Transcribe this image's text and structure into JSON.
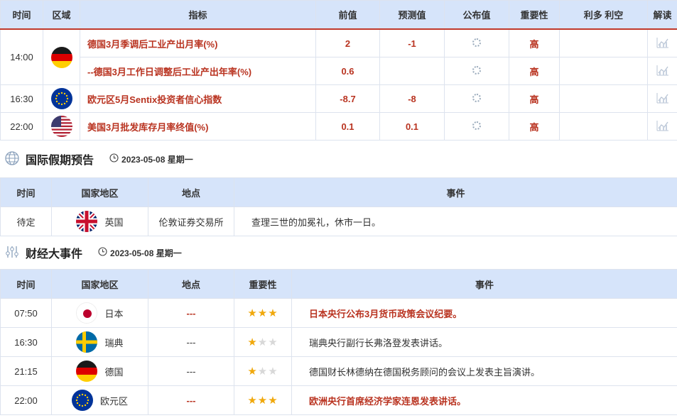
{
  "calendar": {
    "headers": [
      "时间",
      "区域",
      "指标",
      "前值",
      "预测值",
      "公布值",
      "重要性",
      "利多 利空",
      "解读"
    ],
    "rows": [
      {
        "time": "14:00",
        "flag": "germany-flag",
        "indicator": "德国3月季调后工业产出月率(%)",
        "prev": "2",
        "forecast": "-1",
        "importance": "高"
      },
      {
        "time": "",
        "flag": "",
        "indicator": "--德国3月工作日调整后工业产出年率(%)",
        "prev": "0.6",
        "forecast": "",
        "importance": "高"
      },
      {
        "time": "16:30",
        "flag": "eu-flag",
        "indicator": "欧元区5月Sentix投资者信心指数",
        "prev": "-8.7",
        "forecast": "-8",
        "importance": "高"
      },
      {
        "time": "22:00",
        "flag": "usa-flag",
        "indicator": "美国3月批发库存月率终值(%)",
        "prev": "0.1",
        "forecast": "0.1",
        "importance": "高"
      }
    ]
  },
  "holidays": {
    "title": "国际假期预告",
    "date": "2023-05-08 星期一",
    "headers": [
      "时间",
      "国家地区",
      "地点",
      "事件"
    ],
    "rows": [
      {
        "time": "待定",
        "country": "英国",
        "location": "伦敦证券交易所",
        "event": "查理三世的加冕礼，休市一日。"
      }
    ]
  },
  "events": {
    "title": "财经大事件",
    "date": "2023-05-08 星期一",
    "headers": [
      "时间",
      "国家地区",
      "地点",
      "重要性",
      "事件"
    ],
    "rows": [
      {
        "time": "07:50",
        "country": "日本",
        "location": "---",
        "stars": 3,
        "event": "日本央行公布3月货币政策会议纪要。"
      },
      {
        "time": "16:30",
        "country": "瑞典",
        "location": "---",
        "stars": 1,
        "event": "瑞典央行副行长弗洛登发表讲话。"
      },
      {
        "time": "21:15",
        "country": "德国",
        "location": "---",
        "stars": 1,
        "event": "德国财长林德纳在德国税务顾问的会议上发表主旨演讲。"
      },
      {
        "time": "22:00",
        "country": "欧元区",
        "location": "---",
        "stars": 3,
        "event": "欧洲央行首席经济学家连恩发表讲话。"
      }
    ]
  },
  "colors": {
    "header_bg": "#d6e4fa",
    "accent_red": "#b93320",
    "star": "#f0a80c"
  }
}
